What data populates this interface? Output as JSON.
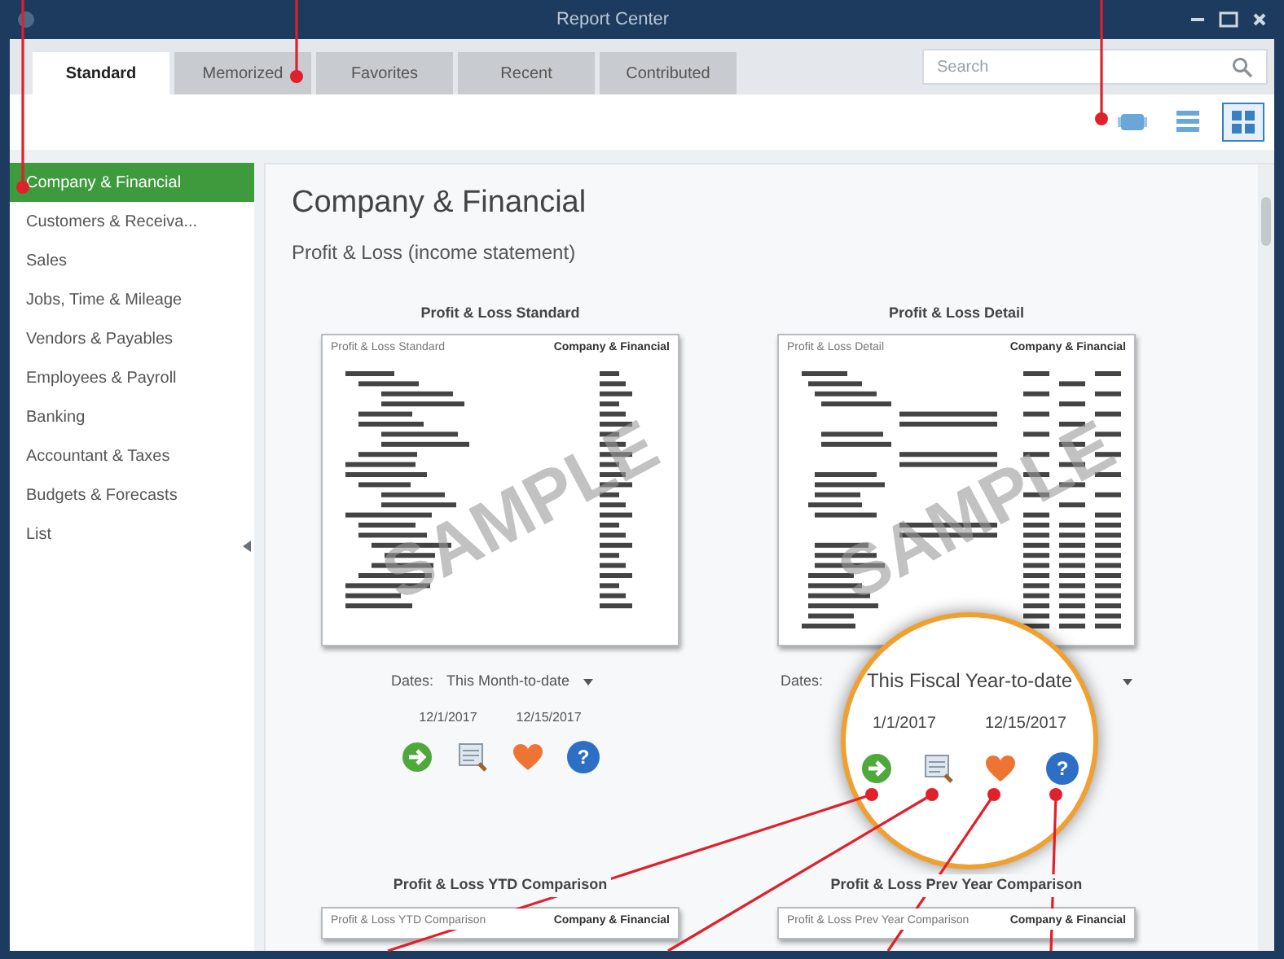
{
  "window": {
    "title": "Report Center"
  },
  "tabs": [
    {
      "label": "Standard",
      "selected": true
    },
    {
      "label": "Memorized",
      "selected": false
    },
    {
      "label": "Favorites",
      "selected": false
    },
    {
      "label": "Recent",
      "selected": false
    },
    {
      "label": "Contributed",
      "selected": false
    }
  ],
  "search": {
    "placeholder": "Search"
  },
  "views": [
    {
      "kind": "carousel",
      "selected": false
    },
    {
      "kind": "list",
      "selected": false
    },
    {
      "kind": "grid",
      "selected": true
    }
  ],
  "sidebar": {
    "items": [
      {
        "label": "Company & Financial",
        "selected": true
      },
      {
        "label": "Customers & Receiva...",
        "selected": false
      },
      {
        "label": "Sales",
        "selected": false
      },
      {
        "label": "Jobs, Time & Mileage",
        "selected": false
      },
      {
        "label": "Vendors & Payables",
        "selected": false
      },
      {
        "label": "Employees & Payroll",
        "selected": false
      },
      {
        "label": "Banking",
        "selected": false
      },
      {
        "label": "Accountant & Taxes",
        "selected": false
      },
      {
        "label": "Budgets & Forecasts",
        "selected": false
      },
      {
        "label": "List",
        "selected": false
      }
    ]
  },
  "content": {
    "heading": "Company & Financial",
    "subheading": "Profit & Loss (income statement)",
    "reports": [
      {
        "title": "Profit & Loss Standard",
        "preview": {
          "kind": "summary",
          "header_left": "Profit & Loss Standard",
          "header_right": "Company & Financial",
          "watermark": "SAMPLE"
        },
        "dates_label": "Dates:",
        "range": "This Month-to-date",
        "start": "12/1/2017",
        "end": "12/15/2017",
        "actions": [
          {
            "kind": "run"
          },
          {
            "kind": "modify"
          },
          {
            "kind": "favorite"
          },
          {
            "kind": "help",
            "glyph": "?"
          }
        ]
      },
      {
        "title": "Profit & Loss Detail",
        "preview": {
          "kind": "detail",
          "header_left": "Profit & Loss Detail",
          "header_right": "Company & Financial",
          "watermark": "SAMPLE"
        },
        "dates_label": "Dates:"
      },
      {
        "title": "Profit & Loss YTD Comparison",
        "preview": {
          "kind": "cut",
          "header_left": "Profit & Loss YTD Comparison",
          "header_right": "Company & Financial"
        }
      },
      {
        "title": "Profit & Loss Prev Year Comparison",
        "preview": {
          "kind": "cut",
          "header_left": "Profit & Loss Prev Year Comparison",
          "header_right": "Company & Financial"
        }
      }
    ]
  },
  "magnifier": {
    "range": "This Fiscal Year-to-date",
    "start": "1/1/2017",
    "end": "12/15/2017",
    "actions": [
      {
        "kind": "run"
      },
      {
        "kind": "modify"
      },
      {
        "kind": "favorite"
      },
      {
        "kind": "help",
        "glyph": "?"
      }
    ]
  }
}
